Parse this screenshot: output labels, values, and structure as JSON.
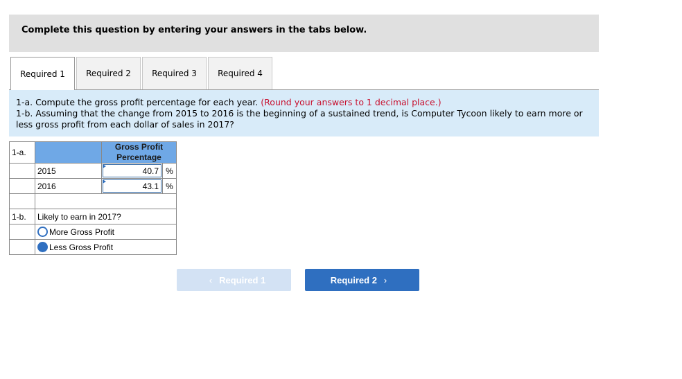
{
  "header": {
    "title": "Complete this question by entering your answers in the tabs below."
  },
  "tabs": [
    {
      "label": "Required 1",
      "active": true
    },
    {
      "label": "Required 2",
      "active": false
    },
    {
      "label": "Required 3",
      "active": false
    },
    {
      "label": "Required 4",
      "active": false
    }
  ],
  "instructions": {
    "line1": "1-a. Compute the gross profit percentage for each year.",
    "line1_note": "(Round your answers to 1 decimal place.)",
    "line2": "1-b. Assuming that the change from 2015 to 2016 is the beginning of a sustained trend, is Computer Tycoon likely to earn more or less gross profit from each dollar of sales in 2017?"
  },
  "part_a": {
    "label": "1-a.",
    "column_header_line1": "Gross Profit",
    "column_header_line2": "Percentage",
    "rows": [
      {
        "year": "2015",
        "value": "40.7",
        "unit": "%"
      },
      {
        "year": "2016",
        "value": "43.1",
        "unit": "%"
      }
    ]
  },
  "part_b": {
    "label": "1-b.",
    "question": "Likely to earn in 2017?",
    "options": [
      {
        "label": "More Gross Profit",
        "selected": false
      },
      {
        "label": "Less Gross Profit",
        "selected": true
      }
    ]
  },
  "nav": {
    "prev_label": "Required 1",
    "next_label": "Required 2",
    "prev_icon": "‹",
    "next_icon": "›"
  },
  "colors": {
    "accent": "#2f6fc0",
    "header_cell": "#6fa8e6",
    "instruction_bg": "#d8ebf9",
    "note_red": "#c8102e"
  }
}
